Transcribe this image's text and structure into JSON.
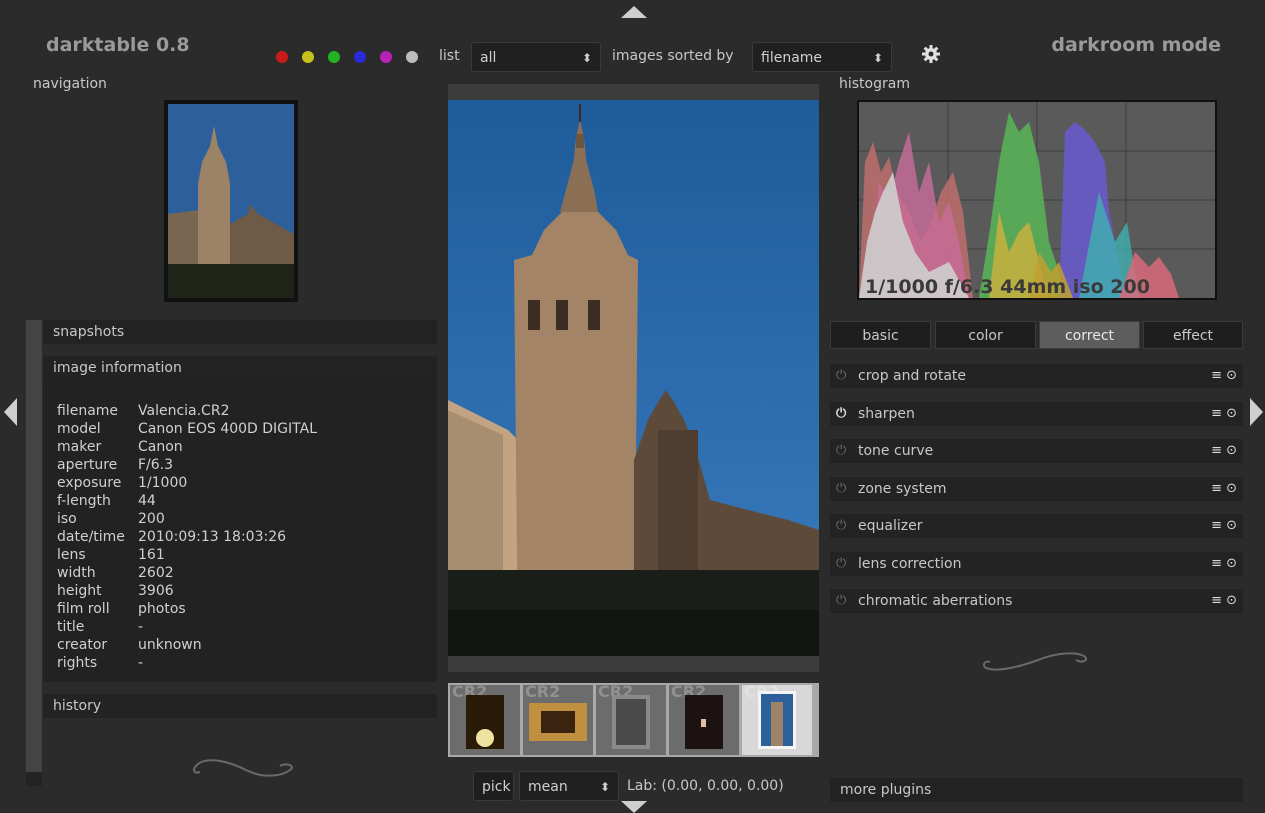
{
  "app_title": "darktable 0.8",
  "mode_title": "darkroom mode",
  "topbar": {
    "color_labels": [
      "#cc1a1a",
      "#c7c21a",
      "#22b322",
      "#2b2bd9",
      "#b822b8",
      "#bdbdbd"
    ],
    "list_label": "list",
    "list_value": "all",
    "sort_label": "images sorted by",
    "sort_value": "filename",
    "settings_icon": "gear-icon"
  },
  "left": {
    "navigation_label": "navigation",
    "snapshots_label": "snapshots",
    "image_info_label": "image information",
    "info_rows": [
      {
        "key": "filename",
        "value": "Valencia.CR2"
      },
      {
        "key": "model",
        "value": "Canon EOS 400D DIGITAL"
      },
      {
        "key": "maker",
        "value": "Canon"
      },
      {
        "key": "aperture",
        "value": "F/6.3"
      },
      {
        "key": "exposure",
        "value": "1/1000"
      },
      {
        "key": "f-length",
        "value": "44"
      },
      {
        "key": "iso",
        "value": "200"
      },
      {
        "key": "date/time",
        "value": "2010:09:13 18:03:26"
      },
      {
        "key": "lens",
        "value": "161"
      },
      {
        "key": "width",
        "value": "2602"
      },
      {
        "key": "height",
        "value": "3906"
      },
      {
        "key": "film roll",
        "value": "photos"
      },
      {
        "key": "title",
        "value": "-"
      },
      {
        "key": "creator",
        "value": "unknown"
      },
      {
        "key": "rights",
        "value": "-"
      }
    ],
    "history_label": "history"
  },
  "filmstrip": {
    "thumbs": [
      {
        "ext": "CR2"
      },
      {
        "ext": "CR2"
      },
      {
        "ext": "CR2"
      },
      {
        "ext": "CR2"
      },
      {
        "ext": "CR2"
      }
    ]
  },
  "bottom": {
    "pick_label": "pick",
    "mean_value": "mean",
    "lab_readout": "Lab: (0.00, 0.00, 0.00)"
  },
  "right": {
    "histogram_label": "histogram",
    "histogram_overlay": "1/1000 f/6.3 44mm iso 200",
    "tabs": [
      {
        "label": "basic",
        "active": false
      },
      {
        "label": "color",
        "active": false
      },
      {
        "label": "correct",
        "active": true
      },
      {
        "label": "effect",
        "active": false
      }
    ],
    "plugins": [
      {
        "name": "crop and rotate",
        "enabled": false
      },
      {
        "name": "sharpen",
        "enabled": true
      },
      {
        "name": "tone curve",
        "enabled": false
      },
      {
        "name": "zone system",
        "enabled": false
      },
      {
        "name": "equalizer",
        "enabled": false
      },
      {
        "name": "lens correction",
        "enabled": false
      },
      {
        "name": "chromatic aberrations",
        "enabled": false
      }
    ],
    "more_plugins_label": "more plugins"
  }
}
